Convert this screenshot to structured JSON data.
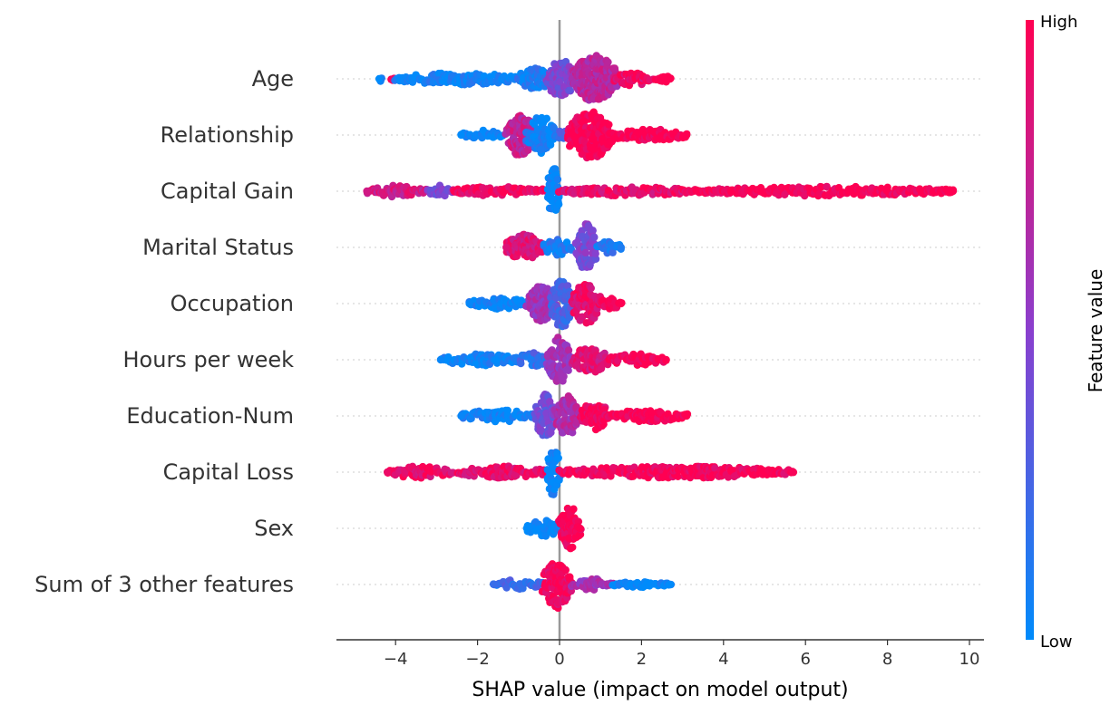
{
  "chart_data": {
    "type": "scatter",
    "subtype": "shap-beeswarm",
    "title": "",
    "xlabel": "SHAP value (impact on model output)",
    "ylabel": "",
    "xlim": [
      -5.4,
      10.4
    ],
    "xticks": [
      -4,
      -2,
      0,
      2,
      4,
      6,
      8,
      10
    ],
    "xtick_labels": [
      "−4",
      "−2",
      "0",
      "2",
      "4",
      "6",
      "8",
      "10"
    ],
    "grid": false,
    "colorbar": {
      "title": "Feature value",
      "high_label": "High",
      "low_label": "Low",
      "low_color": "#008bfb",
      "mid_color": "#8a3fce",
      "high_color": "#ff0052"
    },
    "features": [
      {
        "name": "Age",
        "min": -4.4,
        "max": 2.7,
        "segments": [
          {
            "from": -4.4,
            "to": -4.4,
            "color": 0.0,
            "width": 0.1
          },
          {
            "from": -4.1,
            "to": -4.1,
            "color": 1.0,
            "width": 0.1
          },
          {
            "from": -4.0,
            "to": -1.0,
            "color": 0.05,
            "width": 0.25
          },
          {
            "from": -1.0,
            "to": -0.2,
            "color": 0.1,
            "width": 0.45
          },
          {
            "from": -0.3,
            "to": 0.4,
            "color": 0.45,
            "width": 0.8
          },
          {
            "from": 0.3,
            "to": 1.4,
            "color": 0.7,
            "width": 1.0
          },
          {
            "from": 1.3,
            "to": 2.2,
            "color": 0.92,
            "width": 0.3
          },
          {
            "from": 2.3,
            "to": 2.7,
            "color": 1.0,
            "width": 0.15
          }
        ]
      },
      {
        "name": "Relationship",
        "min": -2.4,
        "max": 3.1,
        "segments": [
          {
            "from": -2.4,
            "to": -1.4,
            "color": 0.0,
            "width": 0.2
          },
          {
            "from": -1.3,
            "to": -0.6,
            "color": 0.75,
            "width": 0.9
          },
          {
            "from": -0.8,
            "to": -0.1,
            "color": 0.05,
            "width": 0.8
          },
          {
            "from": -0.1,
            "to": 0.2,
            "color": 0.2,
            "width": 0.2
          },
          {
            "from": 0.2,
            "to": 1.3,
            "color": 1.0,
            "width": 1.0
          },
          {
            "from": 1.2,
            "to": 3.1,
            "color": 1.0,
            "width": 0.25
          }
        ]
      },
      {
        "name": "Capital Gain",
        "min": -4.7,
        "max": 9.6,
        "segments": [
          {
            "from": -4.7,
            "to": -3.2,
            "color": 0.8,
            "width": 0.25
          },
          {
            "from": -3.2,
            "to": -2.6,
            "color": 0.45,
            "width": 0.25
          },
          {
            "from": -2.6,
            "to": -0.3,
            "color": 0.95,
            "width": 0.2
          },
          {
            "from": -0.3,
            "to": 0.0,
            "color": 0.0,
            "width": 1.0
          },
          {
            "from": 0.0,
            "to": 3.3,
            "color": 0.9,
            "width": 0.2
          },
          {
            "from": 3.3,
            "to": 9.6,
            "color": 1.0,
            "width": 0.2
          }
        ]
      },
      {
        "name": "Marital Status",
        "min": -1.3,
        "max": 1.5,
        "segments": [
          {
            "from": -1.3,
            "to": -0.4,
            "color": 0.85,
            "width": 0.55
          },
          {
            "from": -0.4,
            "to": 0.3,
            "color": 0.1,
            "width": 0.35
          },
          {
            "from": 0.4,
            "to": 0.9,
            "color": 0.45,
            "width": 1.0
          },
          {
            "from": 0.9,
            "to": 1.5,
            "color": 0.1,
            "width": 0.25
          }
        ]
      },
      {
        "name": "Occupation",
        "min": -2.2,
        "max": 1.5,
        "segments": [
          {
            "from": -2.2,
            "to": -0.8,
            "color": 0.02,
            "width": 0.25
          },
          {
            "from": -0.8,
            "to": -0.1,
            "color": 0.6,
            "width": 0.75
          },
          {
            "from": -0.2,
            "to": 0.3,
            "color": 0.25,
            "width": 1.0
          },
          {
            "from": 0.3,
            "to": 1.0,
            "color": 0.9,
            "width": 0.85
          },
          {
            "from": 1.0,
            "to": 1.5,
            "color": 1.0,
            "width": 0.25
          }
        ]
      },
      {
        "name": "Hours per week",
        "min": -2.9,
        "max": 2.6,
        "segments": [
          {
            "from": -2.9,
            "to": -1.0,
            "color": 0.03,
            "width": 0.25
          },
          {
            "from": -1.0,
            "to": -0.3,
            "color": 0.2,
            "width": 0.3
          },
          {
            "from": -0.3,
            "to": 0.3,
            "color": 0.6,
            "width": 1.0
          },
          {
            "from": 0.3,
            "to": 1.2,
            "color": 0.85,
            "width": 0.55
          },
          {
            "from": 1.2,
            "to": 2.6,
            "color": 1.0,
            "width": 0.25
          }
        ]
      },
      {
        "name": "Education-Num",
        "min": -2.4,
        "max": 3.1,
        "segments": [
          {
            "from": -2.4,
            "to": -0.6,
            "color": 0.03,
            "width": 0.25
          },
          {
            "from": -0.6,
            "to": -0.1,
            "color": 0.4,
            "width": 0.95
          },
          {
            "from": -0.1,
            "to": 0.5,
            "color": 0.65,
            "width": 0.85
          },
          {
            "from": 0.5,
            "to": 1.2,
            "color": 0.95,
            "width": 0.6
          },
          {
            "from": 1.2,
            "to": 3.1,
            "color": 1.0,
            "width": 0.25
          }
        ]
      },
      {
        "name": "Capital Loss",
        "min": -4.2,
        "max": 5.7,
        "segments": [
          {
            "from": -4.2,
            "to": -2.6,
            "color": 0.92,
            "width": 0.25
          },
          {
            "from": -2.5,
            "to": -0.3,
            "color": 0.9,
            "width": 0.25
          },
          {
            "from": -0.3,
            "to": 0.0,
            "color": 0.0,
            "width": 1.0
          },
          {
            "from": 0.0,
            "to": 5.7,
            "color": 0.97,
            "width": 0.25
          }
        ]
      },
      {
        "name": "Sex",
        "min": -0.8,
        "max": 0.5,
        "segments": [
          {
            "from": -0.8,
            "to": 0.0,
            "color": 0.0,
            "width": 0.35
          },
          {
            "from": 0.0,
            "to": 0.5,
            "color": 1.0,
            "width": 0.9
          }
        ]
      },
      {
        "name": "Sum of 3 other features",
        "min": -1.6,
        "max": 2.7,
        "segments": [
          {
            "from": -1.6,
            "to": -0.4,
            "color": 0.2,
            "width": 0.2
          },
          {
            "from": -0.4,
            "to": 0.3,
            "color": 0.95,
            "width": 1.0
          },
          {
            "from": 0.3,
            "to": 1.3,
            "color": 0.6,
            "width": 0.25
          },
          {
            "from": 1.3,
            "to": 2.7,
            "color": 0.0,
            "width": 0.12
          }
        ]
      }
    ]
  }
}
